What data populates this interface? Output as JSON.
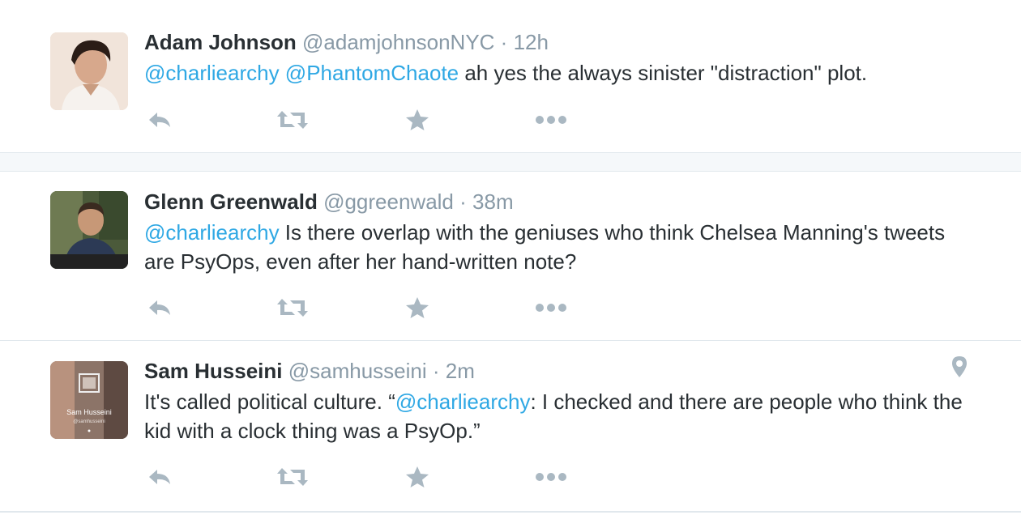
{
  "tweets": [
    {
      "name": "Adam Johnson",
      "handle": "@adamjohnsonNYC",
      "separator": "·",
      "time": "12h",
      "text": [
        {
          "type": "mention",
          "text": "@charliearchy"
        },
        {
          "type": "plain",
          "text": " "
        },
        {
          "type": "mention",
          "text": "@PhantomChaote"
        },
        {
          "type": "plain",
          "text": " ah yes the always sinister \"distraction\" plot."
        }
      ]
    },
    {
      "name": "Glenn Greenwald",
      "handle": "@ggreenwald",
      "separator": "·",
      "time": "38m",
      "text": [
        {
          "type": "mention",
          "text": "@charliearchy"
        },
        {
          "type": "plain",
          "text": " Is there overlap with the geniuses who think Chelsea Manning's tweets are PsyOps, even after her hand-written note?"
        }
      ]
    },
    {
      "name": "Sam Husseini",
      "handle": "@samhusseini",
      "separator": "·",
      "time": "2m",
      "avatar_caption": "Sam Husseini",
      "avatar_subcaption": "@samhusseini",
      "text": [
        {
          "type": "plain",
          "text": "It's called political culture. “"
        },
        {
          "type": "mention",
          "text": "@charliearchy"
        },
        {
          "type": "plain",
          "text": ": I checked and there are people who think the kid with a clock thing was a PsyOp.”"
        }
      ]
    }
  ],
  "icons": [
    "reply-icon",
    "retweet-icon",
    "favorite-icon",
    "more-icon",
    "location-pin-icon"
  ],
  "colors": {
    "mention": "#2fa8e4",
    "muted": "#8899a6",
    "icon": "#aab8c2",
    "thread": "#55d0ef"
  }
}
